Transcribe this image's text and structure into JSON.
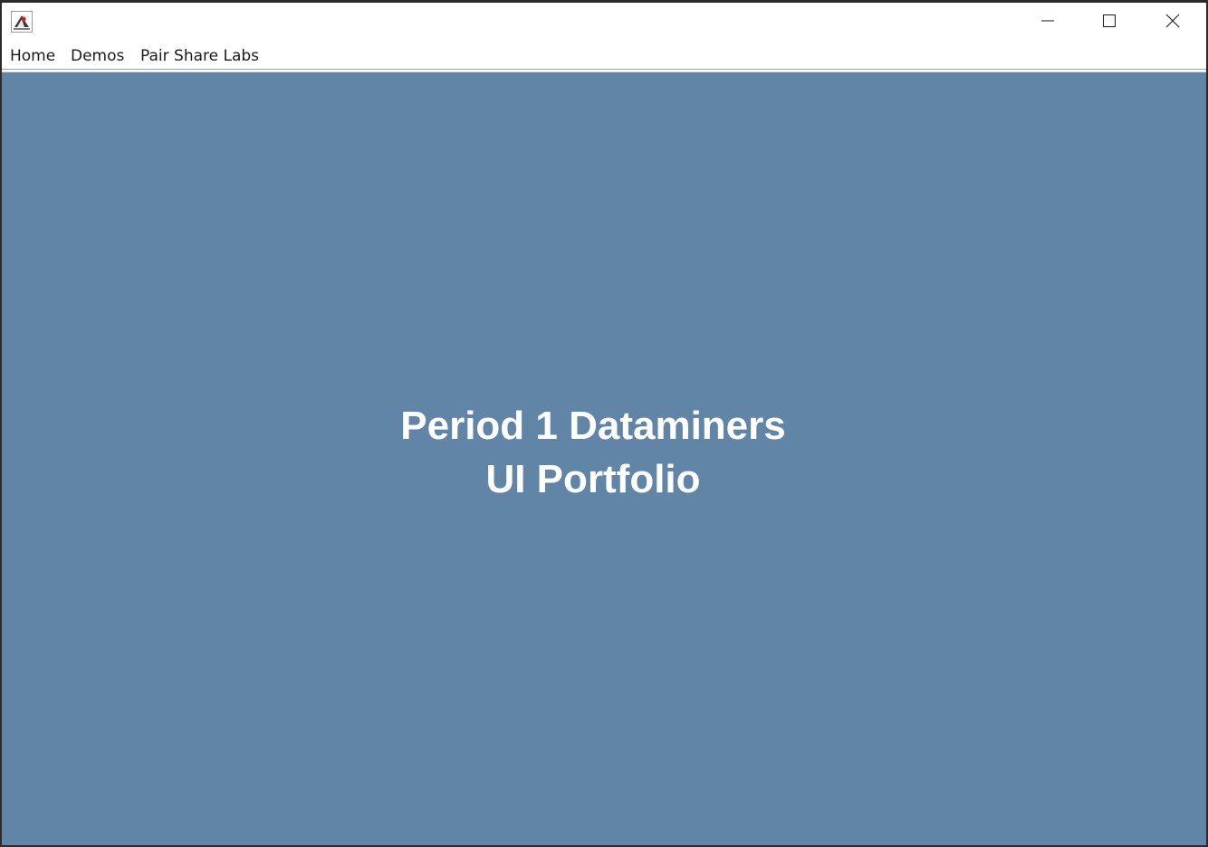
{
  "window": {
    "app_icon": "java-duke-icon",
    "controls": {
      "minimize": "minimize-icon",
      "maximize": "maximize-icon",
      "close": "close-icon"
    }
  },
  "menu": {
    "items": [
      "Home",
      "Demos",
      "Pair Share Labs"
    ]
  },
  "main": {
    "title_line1": "Period 1 Dataminers",
    "title_line2": "UI Portfolio",
    "background_color": "#6185a7",
    "text_color": "#ffffff"
  }
}
